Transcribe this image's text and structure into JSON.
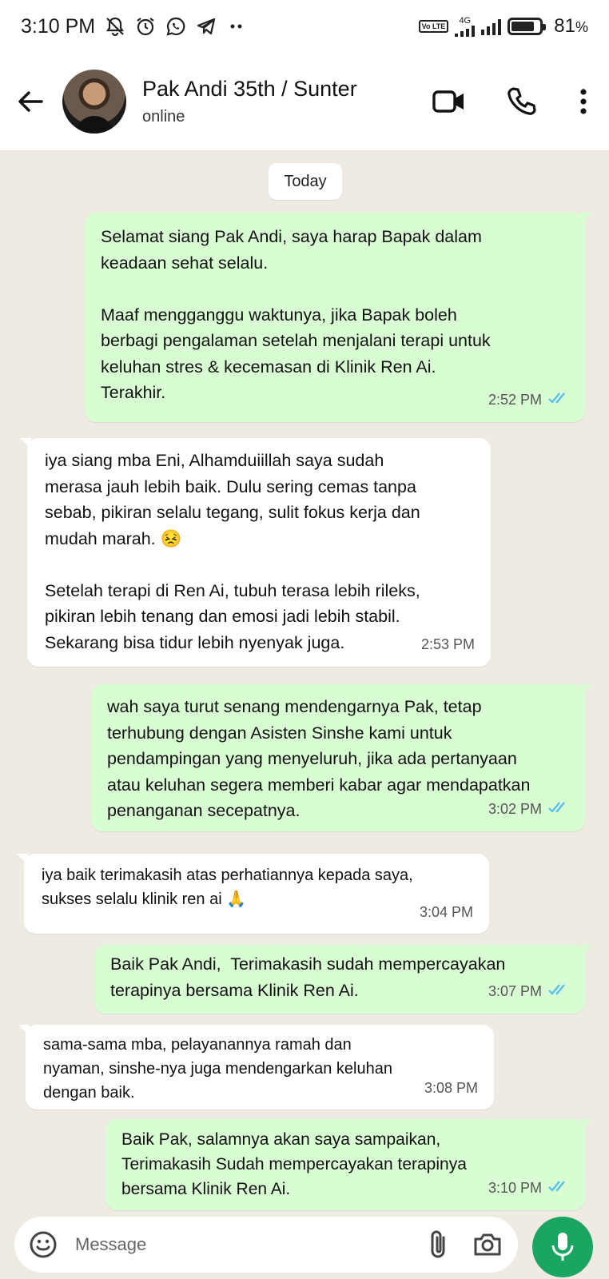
{
  "status_bar": {
    "time": "3:10 PM",
    "icons": [
      "mute-icon",
      "alarm-icon",
      "whatsapp-icon",
      "telegram-icon",
      "more-dots-icon"
    ],
    "network": "4G",
    "lte_label": "Vo LTE",
    "battery_percent": "81",
    "battery_suffix": "%"
  },
  "header": {
    "contact_name": "Pak Andi 35th / Sunter",
    "presence": "online",
    "icons": [
      "back-arrow-icon",
      "video-call-icon",
      "voice-call-icon",
      "overflow-menu-icon"
    ]
  },
  "chat": {
    "day_label": "Today",
    "messages": [
      {
        "direction": "out",
        "text": "Selamat siang Pak Andi, saya harap Bapak dalam\nkeadaan sehat selalu.\n\nMaaf mengganggu waktunya, jika Bapak boleh\nberbagi pengalaman setelah menjalani terapi untuk\nkeluhan stres & kecemasan di Klinik Ren Ai.\nTerakhir.",
        "time": "2:52 PM",
        "read": true
      },
      {
        "direction": "in",
        "text": "iya siang mba Eni, Alhamduiillah saya sudah\nmerasa jauh lebih baik. Dulu sering cemas tanpa\nsebab, pikiran selalu tegang, sulit fokus kerja dan\nmudah marah. 😣\n\nSetelah terapi di Ren Ai, tubuh terasa lebih rileks,\npikiran lebih tenang dan emosi jadi lebih stabil.\nSekarang bisa tidur lebih nyenyak juga.",
        "time": "2:53 PM"
      },
      {
        "direction": "out",
        "text": "wah saya turut senang mendengarnya Pak, tetap\nterhubung dengan Asisten Sinshe kami untuk\npendampingan yang menyeluruh, jika ada pertanyaan\natau keluhan segera memberi kabar agar mendapatkan\npenanganan secepatnya.",
        "time": "3:02 PM",
        "read": true
      },
      {
        "direction": "in",
        "text": "iya baik terimakasih atas perhatiannya kepada saya,\nsukses selalu klinik ren ai 🙏",
        "time": "3:04 PM"
      },
      {
        "direction": "out",
        "text": "Baik Pak Andi,  Terimakasih sudah mempercayakan\nterapinya bersama Klinik Ren Ai.",
        "time": "3:07 PM",
        "read": true
      },
      {
        "direction": "in",
        "text": "sama-sama mba, pelayanannya ramah dan\nnyaman, sinshe-nya juga mendengarkan keluhan\ndengan baik.",
        "time": "3:08 PM"
      },
      {
        "direction": "out",
        "text": "Baik Pak, salamnya akan saya sampaikan,\nTerimakasih Sudah mempercayakan terapinya\nbersama Klinik Ren Ai.",
        "time": "3:10 PM",
        "read": true
      }
    ]
  },
  "composer": {
    "placeholder": "Message",
    "icons": [
      "emoji-icon",
      "attach-icon",
      "camera-icon",
      "mic-icon"
    ],
    "accent_color": "#1aa561",
    "outgoing_bubble_color": "#d9fdd3",
    "read_tick_color": "#53bdeb"
  }
}
